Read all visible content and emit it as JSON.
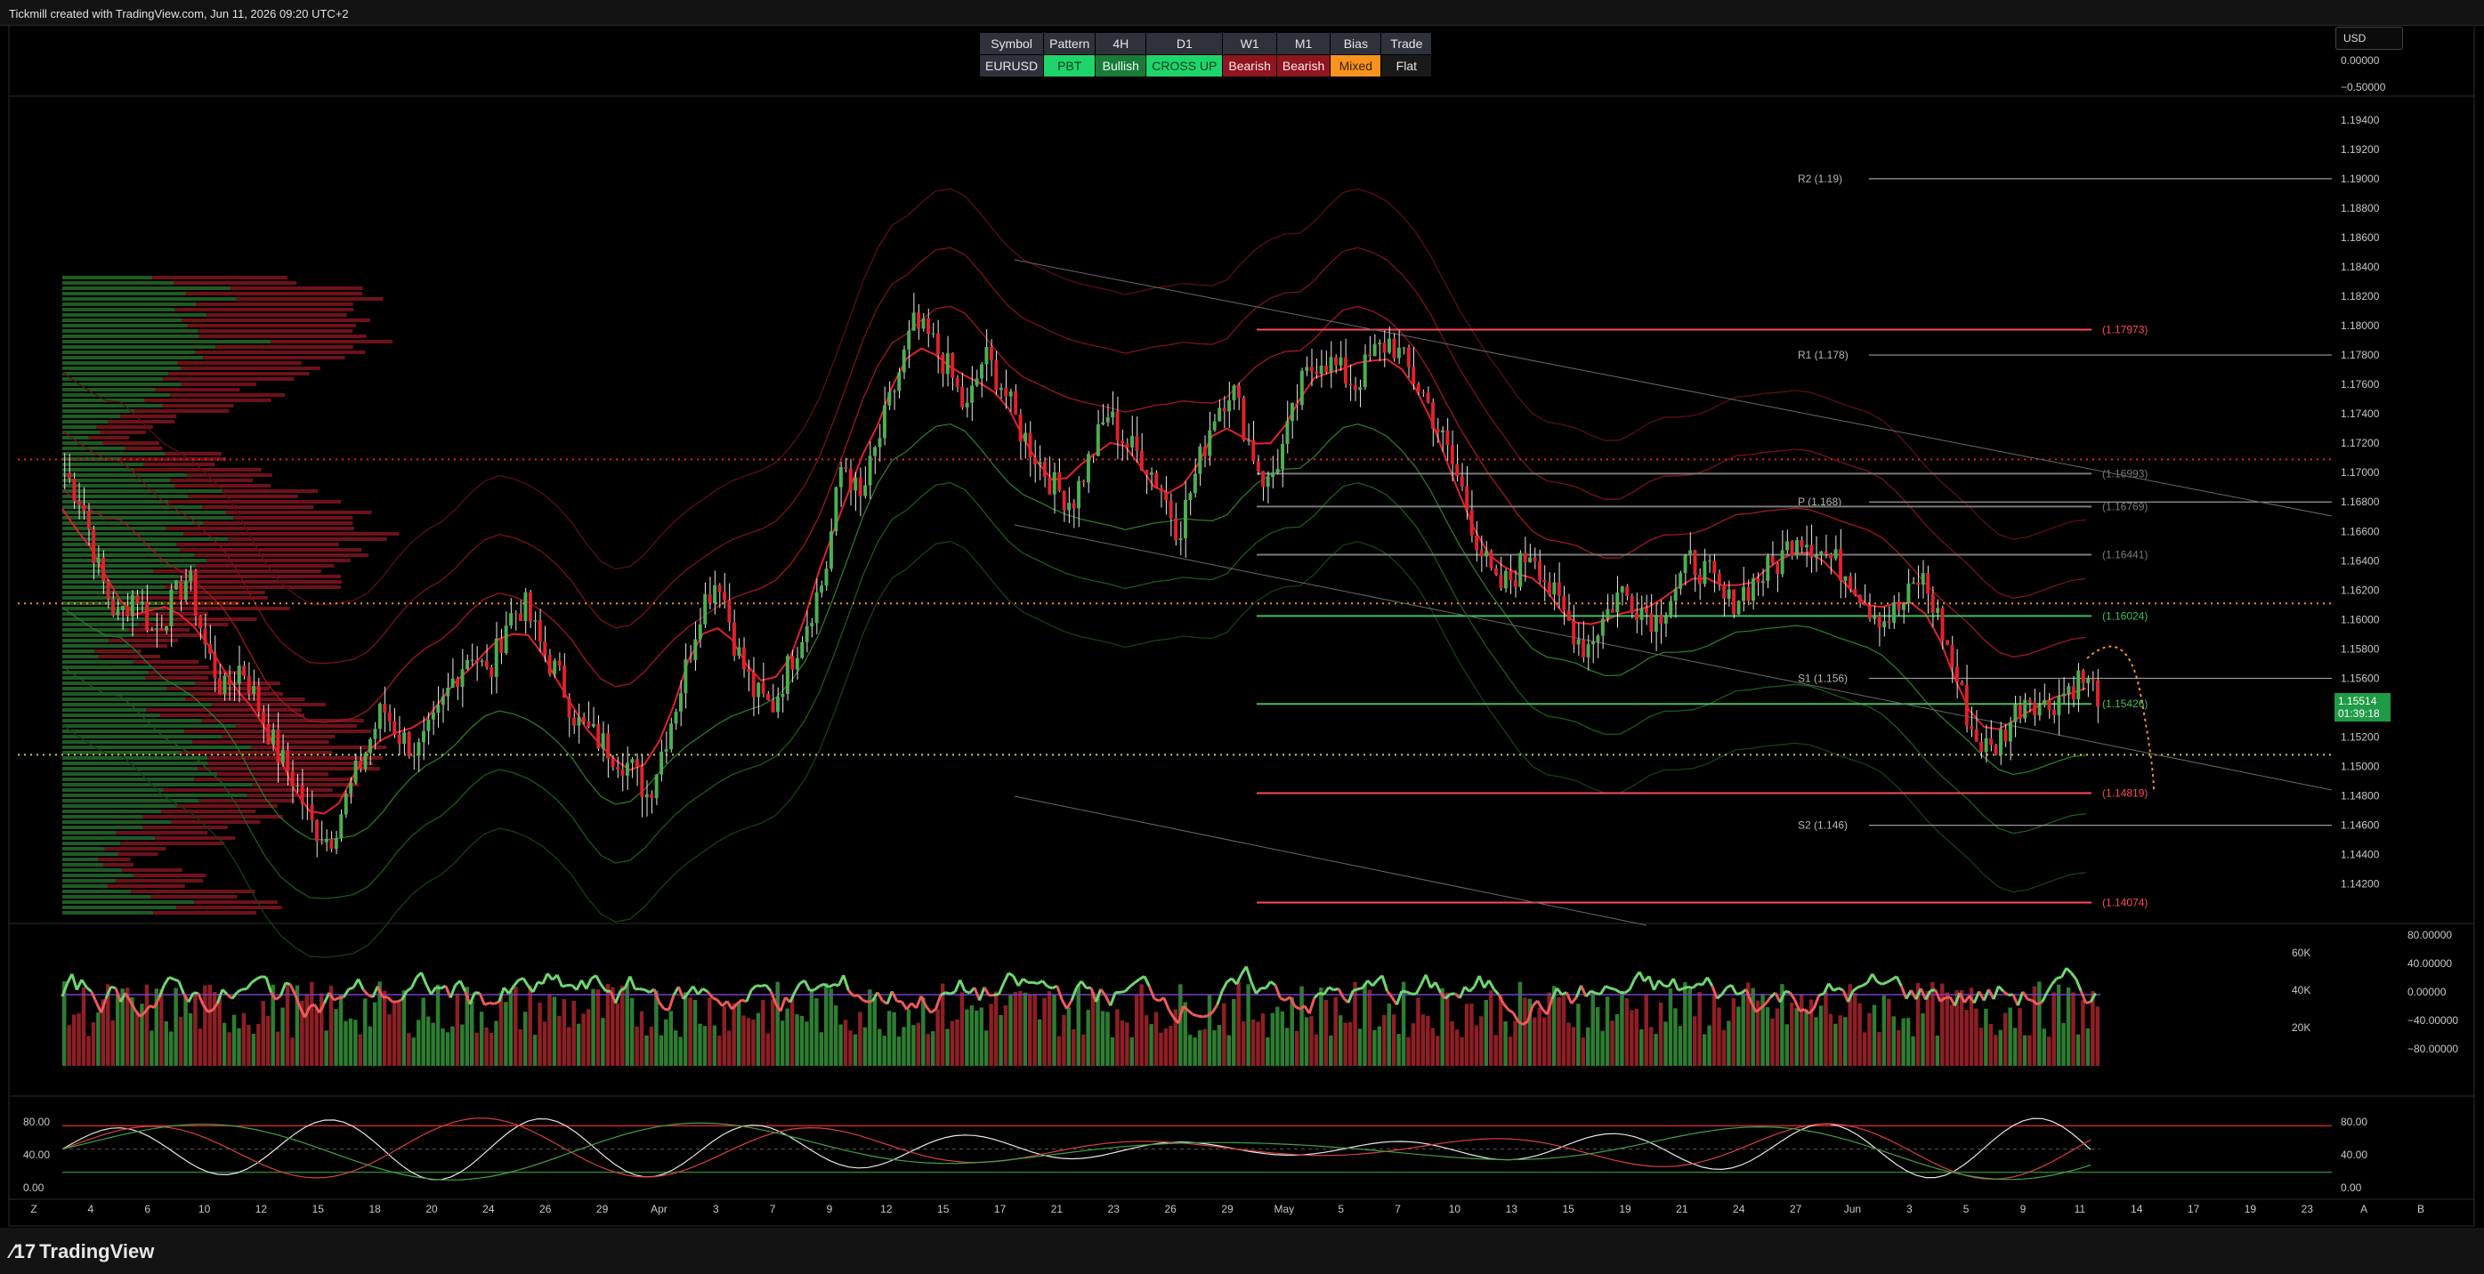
{
  "header": {
    "caption": "Tickmill created with TradingView.com, Jun 11, 2026 09:20 UTC+2"
  },
  "footer": {
    "logo_text": "TradingView"
  },
  "currency_selector": {
    "value": "USD"
  },
  "price_tag": {
    "price": "1.15514",
    "countdown": "01:39:18"
  },
  "signal_table": {
    "headers": [
      "Symbol",
      "Pattern",
      "4H",
      "D1",
      "W1",
      "M1",
      "Bias",
      "Trade"
    ],
    "values": [
      "EURUSD",
      "PBT",
      "Bullish",
      "CROSS UP",
      "Bearish",
      "Bearish",
      "Mixed",
      "Flat"
    ],
    "cell_colors": [
      "#2f323b",
      "#1fd56b",
      "#1a7a3a",
      "#1fd56b",
      "#8e1620",
      "#8e1620",
      "#f7931e",
      "#1a1a1a"
    ],
    "text_colors": [
      "#e6e6e6",
      "#0c3d1f",
      "#e6ffe6",
      "#0c3d1f",
      "#ffe6e6",
      "#ffe6e6",
      "#3d2200",
      "#e6e6e6"
    ]
  },
  "colors": {
    "bull": "#4caf50",
    "bear": "#e0222b",
    "wick": "#e8e8e8",
    "osc_up": "#6fd86f",
    "osc_down": "#f05a5a"
  },
  "chart_data": [
    {
      "type": "candlestick",
      "title": "EURUSD",
      "yaxis_ticks": [
        "1.19400",
        "1.19200",
        "1.19000",
        "1.18800",
        "1.18600",
        "1.18400",
        "1.18200",
        "1.18000",
        "1.17800",
        "1.17600",
        "1.17400",
        "1.17200",
        "1.17000",
        "1.16800",
        "1.16600",
        "1.16400",
        "1.16200",
        "1.16000",
        "1.15800",
        "1.15600",
        "1.15400",
        "1.15200",
        "1.15000",
        "1.14800",
        "1.14600",
        "1.14400",
        "1.14200"
      ],
      "ylim": [
        1.1395,
        1.1955
      ],
      "xaxis_ticks": [
        "Z",
        "4",
        "6",
        "10",
        "12",
        "15",
        "18",
        "20",
        "24",
        "26",
        "29",
        "Apr",
        "3",
        "7",
        "9",
        "12",
        "15",
        "17",
        "21",
        "23",
        "26",
        "29",
        "May",
        "5",
        "7",
        "10",
        "13",
        "15",
        "19",
        "21",
        "24",
        "27",
        "Jun",
        "3",
        "5",
        "9",
        "11",
        "14",
        "17",
        "19",
        "23",
        "A",
        "B"
      ],
      "pivot_levels": [
        {
          "label": "R2 (1.19)",
          "value": 1.19
        },
        {
          "label": "R1 (1.178)",
          "value": 1.178
        },
        {
          "label": "P (1.168)",
          "value": 1.168
        },
        {
          "label": "S1 (1.156)",
          "value": 1.156
        },
        {
          "label": "S2 (1.146)",
          "value": 1.146
        }
      ],
      "levels": [
        {
          "label": "(1.17973)",
          "value": 1.17973,
          "color": "#ff4a5a"
        },
        {
          "label": "(1.16993)",
          "value": 1.16993,
          "color": "#7a7a7a"
        },
        {
          "label": "(1.16769)",
          "value": 1.16769,
          "color": "#7a7a7a"
        },
        {
          "label": "(1.16441)",
          "value": 1.16441,
          "color": "#7a7a7a"
        },
        {
          "label": "(1.16024)",
          "value": 1.16024,
          "color": "#3fbf5a"
        },
        {
          "label": "(1.15426)",
          "value": 1.15426,
          "color": "#3fbf5a"
        },
        {
          "label": "(1.14819)",
          "value": 1.14819,
          "color": "#ff4a5a"
        },
        {
          "label": "(1.14074)",
          "value": 1.14074,
          "color": "#ff4a5a"
        }
      ],
      "dotted_levels": [
        {
          "value": 1.1709,
          "color": "#e0222b"
        },
        {
          "value": 1.1611,
          "color": "#f7931e"
        },
        {
          "value": 1.1508,
          "color": "#c9d23a"
        }
      ],
      "last_price": 1.15514,
      "close_path": [
        1.17,
        1.168,
        1.163,
        1.16,
        1.162,
        1.159,
        1.161,
        1.163,
        1.158,
        1.155,
        1.157,
        1.154,
        1.151,
        1.149,
        1.146,
        1.145,
        1.148,
        1.151,
        1.154,
        1.152,
        1.151,
        1.153,
        1.156,
        1.158,
        1.156,
        1.16,
        1.161,
        1.158,
        1.156,
        1.153,
        1.152,
        1.151,
        1.15,
        1.148,
        1.152,
        1.156,
        1.161,
        1.163,
        1.158,
        1.155,
        1.154,
        1.157,
        1.16,
        1.163,
        1.171,
        1.168,
        1.172,
        1.176,
        1.18,
        1.179,
        1.177,
        1.174,
        1.178,
        1.176,
        1.173,
        1.171,
        1.169,
        1.168,
        1.171,
        1.174,
        1.172,
        1.171,
        1.169,
        1.166,
        1.17,
        1.174,
        1.176,
        1.172,
        1.169,
        1.172,
        1.176,
        1.178,
        1.177,
        1.176,
        1.178,
        1.179,
        1.177,
        1.175,
        1.172,
        1.169,
        1.165,
        1.162,
        1.163,
        1.165,
        1.162,
        1.16,
        1.158,
        1.16,
        1.162,
        1.161,
        1.16,
        1.162,
        1.164,
        1.163,
        1.161,
        1.162,
        1.163,
        1.164,
        1.166,
        1.165,
        1.164,
        1.163,
        1.161,
        1.16,
        1.161,
        1.163,
        1.16,
        1.156,
        1.152,
        1.151,
        1.153,
        1.155,
        1.154,
        1.155,
        1.156,
        1.155
      ]
    },
    {
      "type": "bar",
      "title": "Volume",
      "yaxis_ticks_left": [
        "60K",
        "40K",
        "20K"
      ],
      "yaxis_ticks_right": [
        "80.00000",
        "40.00000",
        "0.00000",
        "−40.00000",
        "−80.00000"
      ],
      "ylim": [
        0,
        70000
      ]
    },
    {
      "type": "line",
      "title": "Stochastic",
      "yaxis_ticks_left": [
        "80.00",
        "40.00",
        "0.00"
      ],
      "yaxis_ticks_right": [
        "80.00",
        "40.00",
        "0.00"
      ],
      "ylim": [
        0,
        100
      ]
    }
  ],
  "price_axis_top": [
    "0.00000",
    "−0.50000"
  ]
}
